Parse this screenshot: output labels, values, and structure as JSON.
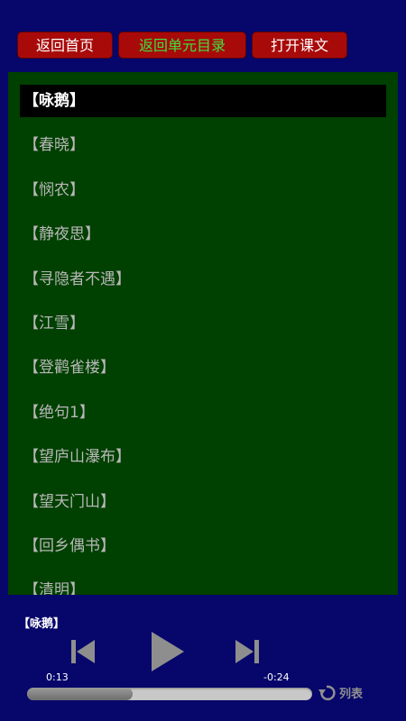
{
  "toolbar": {
    "home_label": "返回首页",
    "unit_label": "返回单元目录",
    "open_label": "打开课文"
  },
  "lessons": [
    {
      "label": "【咏鹅】",
      "selected": true
    },
    {
      "label": "【春晓】"
    },
    {
      "label": "【悯农】"
    },
    {
      "label": "【静夜思】"
    },
    {
      "label": "【寻隐者不遇】"
    },
    {
      "label": "【江雪】"
    },
    {
      "label": "【登鹳雀楼】"
    },
    {
      "label": "【绝句1】"
    },
    {
      "label": "【望庐山瀑布】"
    },
    {
      "label": "【望天门山】"
    },
    {
      "label": "【回乡偶书】"
    },
    {
      "label": "【清明】"
    }
  ],
  "player": {
    "now_playing": "【咏鹅】",
    "elapsed": "0:13",
    "remaining": "-0:24",
    "progress": 0.37,
    "loop_label": "列表",
    "icons": [
      "skip-previous-icon",
      "play-icon",
      "skip-next-icon",
      "repeat-icon"
    ]
  },
  "colors": {
    "background": "#06066b",
    "button": "#a80a0a",
    "list_panel": "#004000",
    "selected_row": "#000000",
    "unit_button_text": "#3fe13f"
  }
}
